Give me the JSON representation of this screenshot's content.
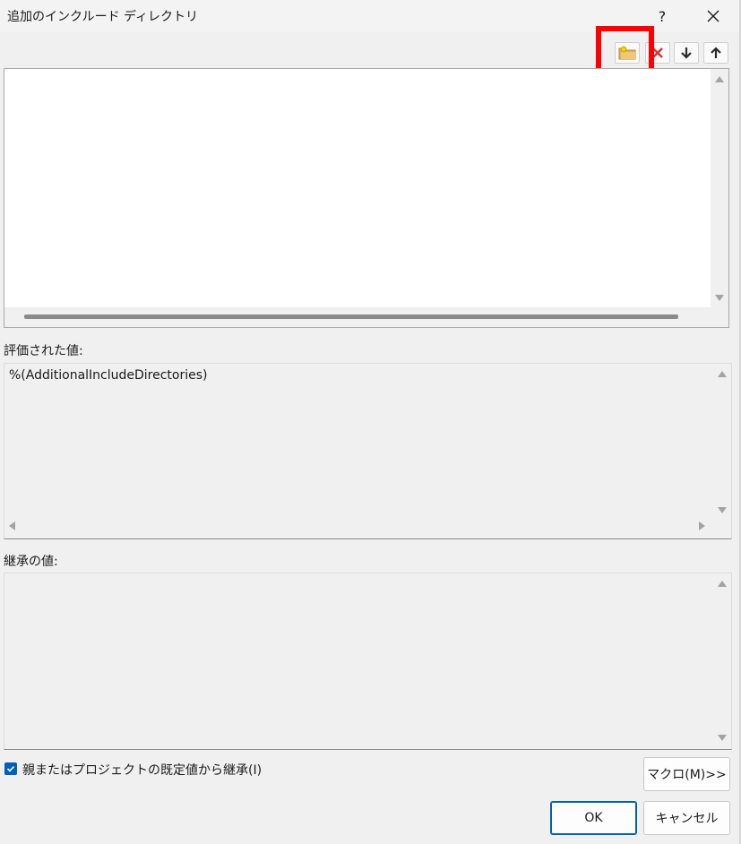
{
  "window": {
    "title": "追加のインクルード ディレクトリ",
    "help_label": "?"
  },
  "toolbar": {
    "icons": [
      "new-folder-icon",
      "delete-icon",
      "move-down-icon",
      "move-up-icon"
    ]
  },
  "evaluated": {
    "label": "評価された値:",
    "value": "%(AdditionalIncludeDirectories)"
  },
  "inherited": {
    "label": "継承の値:"
  },
  "inherit_checkbox": {
    "label": "親またはプロジェクトの既定値から継承(I)",
    "checked": true
  },
  "buttons": {
    "macro": "マクロ(M)>>",
    "ok": "OK",
    "cancel": "キャンセル"
  },
  "colors": {
    "accent": "#005fb8",
    "highlight": "#ff0000"
  }
}
